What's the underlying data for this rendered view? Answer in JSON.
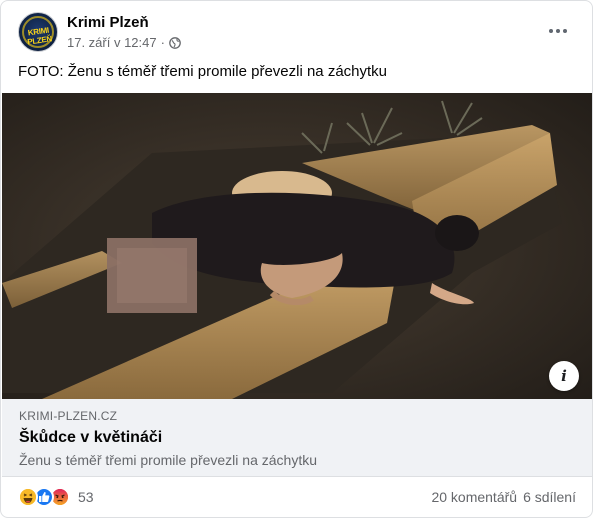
{
  "post": {
    "page_name": "Krimi Plzeň",
    "timestamp": "17. září v 12:47",
    "separator": "·",
    "privacy_icon": "globe-icon",
    "avatar_text": "KRIMI PLZEŇ",
    "text": "FOTO: Ženu s téměř třemi promile převezli na záchytku"
  },
  "link_preview": {
    "domain": "KRIMI-PLZEN.CZ",
    "title": "Škůdce v květináči",
    "description": "Ženu s téměř třemi promile převezli na záchytku",
    "info_label": "i"
  },
  "footer": {
    "reactions": [
      "haha-reaction-icon",
      "like-reaction-icon",
      "angry-reaction-icon"
    ],
    "reaction_count": "53",
    "comments": "20 komentářů",
    "shares": "6 sdílení"
  },
  "colors": {
    "primary_text": "#050505",
    "secondary_text": "#65676b",
    "link_box_bg": "#f0f2f5",
    "like_blue": "#1877f2",
    "haha_yellow": "#f7b928",
    "angry_orange": "#e9710f"
  }
}
